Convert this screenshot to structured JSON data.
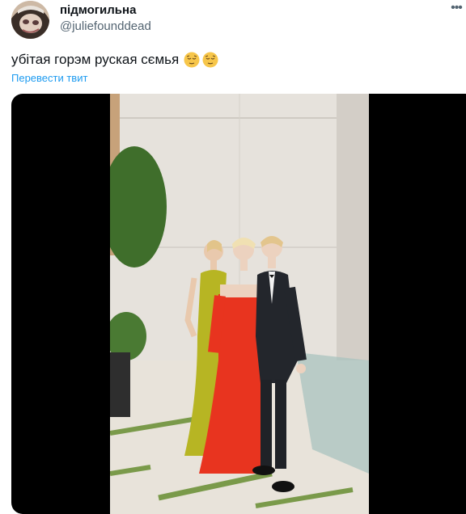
{
  "author": {
    "display_name": "підмогильна",
    "handle": "@juliefounddead",
    "avatar_icon": "avatar-photo"
  },
  "menu": {
    "more_icon": "more-icon",
    "more_glyph": "•••"
  },
  "tweet": {
    "text": "убітая горэм руская сємья",
    "emojis": [
      "relieved-face-emoji",
      "relieved-face-emoji"
    ],
    "translate_label": "Перевести твит"
  },
  "media": {
    "type": "photo",
    "icon": "photo-image"
  },
  "colors": {
    "link": "#1d9bf0",
    "secondary_text": "#536471",
    "media_bg": "#000000"
  }
}
